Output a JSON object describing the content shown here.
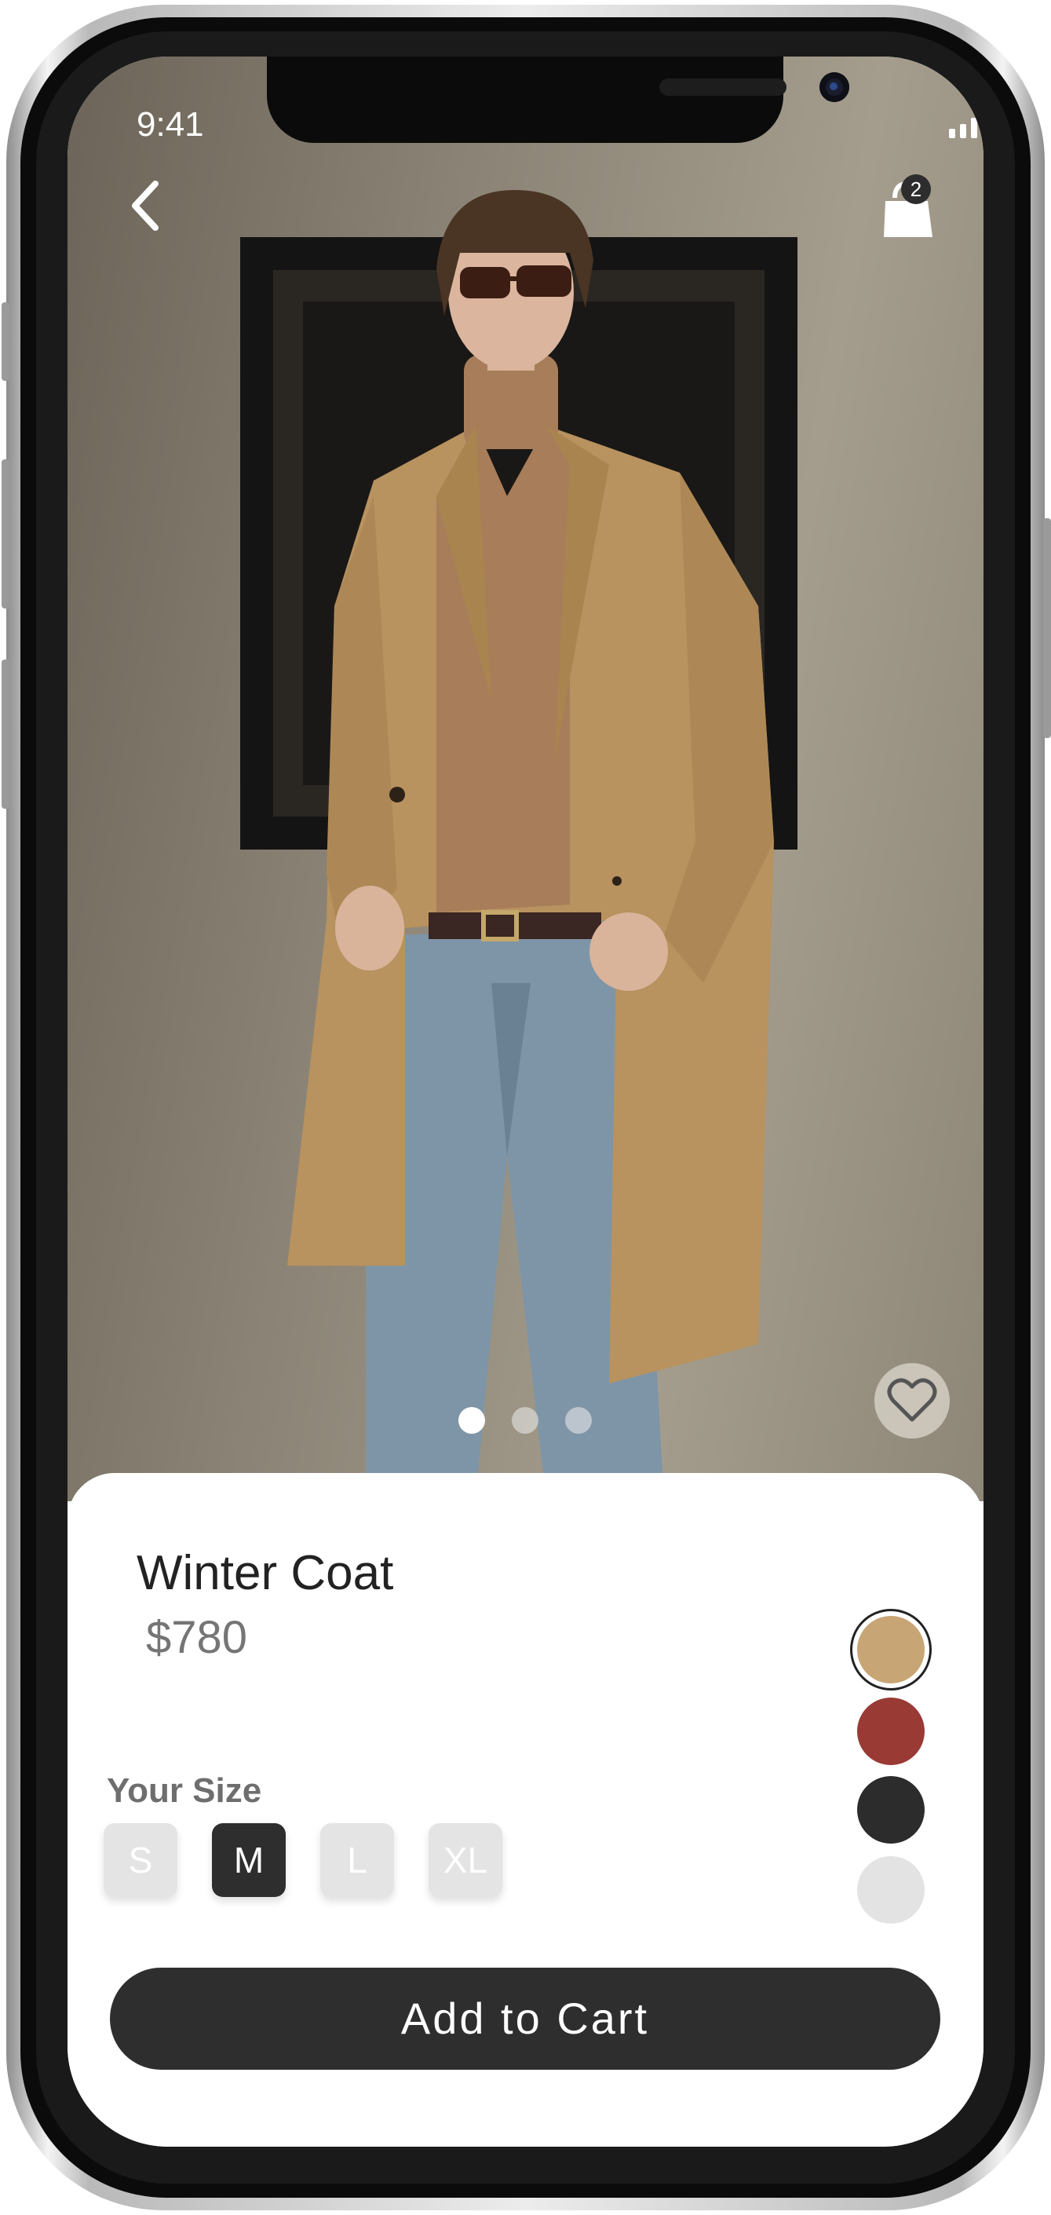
{
  "status_bar": {
    "time": "9:41"
  },
  "header": {
    "back_icon": "chevron-left-icon",
    "bag_icon": "shopping-bag-icon",
    "bag_count": "2"
  },
  "gallery": {
    "total_images": 3,
    "active_index": 0,
    "favorite_icon": "heart-outline-icon"
  },
  "product": {
    "name": "Winter Coat",
    "price": "$780"
  },
  "size": {
    "label": "Your Size",
    "options": [
      "S",
      "M",
      "L",
      "XL"
    ],
    "selected": "M"
  },
  "colors": {
    "options": [
      "#c8a574",
      "#993a35",
      "#2c2c2c",
      "#e3e3e3"
    ],
    "selected": "#c8a574"
  },
  "actions": {
    "add_to_cart": "Add to Cart"
  }
}
